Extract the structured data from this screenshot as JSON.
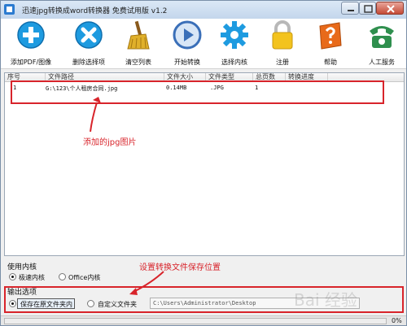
{
  "window": {
    "title": "迅速jpg转换成word转换器 免费试用版 v1.2"
  },
  "toolbar": {
    "buttons": [
      {
        "label": "添加PDF/图像",
        "icon": "add-plus-icon",
        "color": "#1e9be0"
      },
      {
        "label": "删除选择项",
        "icon": "delete-x-icon",
        "color": "#1e9be0"
      },
      {
        "label": "清空列表",
        "icon": "broom-icon",
        "color": "#d9a21c"
      },
      {
        "label": "开始转换",
        "icon": "play-icon",
        "color": "#3a6fb8"
      },
      {
        "label": "选择内核",
        "icon": "gear-icon",
        "color": "#1e9be0"
      },
      {
        "label": "注册",
        "icon": "lock-icon",
        "color": "#f3c31e"
      },
      {
        "label": "帮助",
        "icon": "help-book-icon",
        "color": "#e86a1a"
      },
      {
        "label": "人工服务",
        "icon": "phone-icon",
        "color": "#2f8f4e"
      }
    ]
  },
  "file_list": {
    "headers": [
      "序号",
      "文件路径",
      "文件大小",
      "文件类型",
      "总页数",
      "转换进度"
    ],
    "rows": [
      {
        "index": "1",
        "path": "G:\\123\\个人租房合同.jpg",
        "size": "0.14MB",
        "type": ".JPG",
        "pages": "1",
        "progress": ""
      }
    ]
  },
  "annotations": {
    "jpg_note": "添加的jpg图片",
    "save_note": "设置转换文件保存位置"
  },
  "kernel": {
    "title": "使用内核",
    "options": [
      "极速内核",
      "Office内核"
    ],
    "selected": "极速内核"
  },
  "output": {
    "title": "输出选项",
    "options": [
      "保存在原文件夹内",
      "自定义文件夹"
    ],
    "selected": "保存在原文件夹内",
    "custom_path": "C:\\Users\\Administrator\\Desktop"
  },
  "status": {
    "progress_label": "0%",
    "progress_value": 0
  },
  "watermark": "Bai 经验"
}
